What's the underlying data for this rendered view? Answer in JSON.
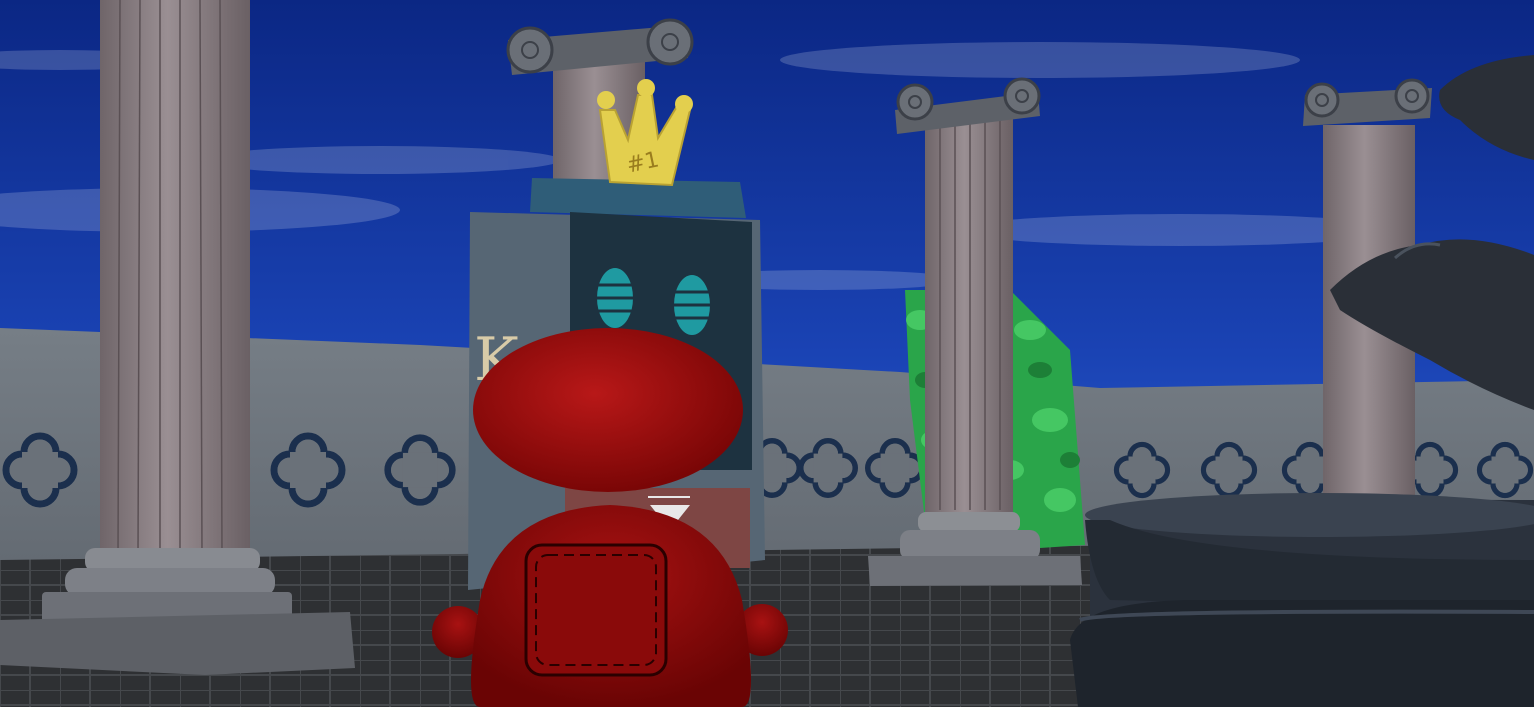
{
  "scene": {
    "crown_label": "#1",
    "sign_glyph": "K"
  },
  "colors": {
    "sky_top": "#0c2a8c",
    "sky_bottom": "#2e63d6",
    "wall": "#6f7780",
    "column": "#8d8386",
    "floor": "#2f3133",
    "crown": "#e3cf4e",
    "kiosk": "#566674",
    "character": "#9b0e0e",
    "fountain": "#2c3440",
    "tree": "#2fae4d"
  }
}
